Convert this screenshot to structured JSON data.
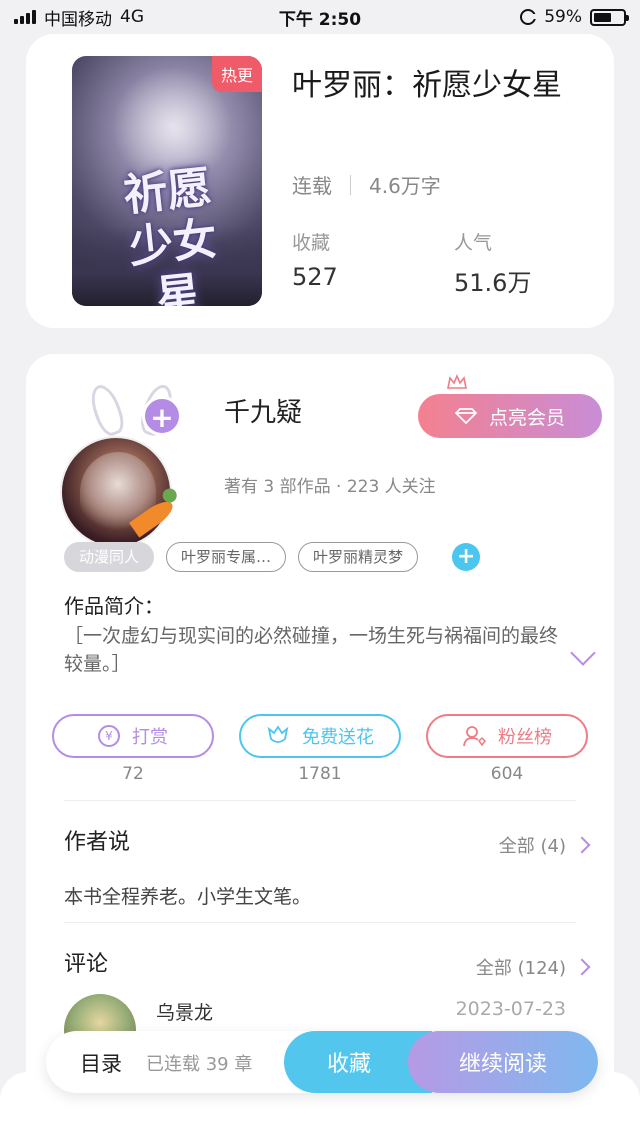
{
  "status_bar": {
    "carrier": "中国移动",
    "network": "4G",
    "time": "下午 2:50",
    "battery": "59%",
    "battery_level": 0.59
  },
  "book": {
    "title": "叶罗丽：祈愿少女星",
    "cover_title": "祈愿少女星",
    "cover_tag": "热更",
    "status": "连载",
    "word_count": "4.6万字",
    "stats": [
      {
        "label": "收藏",
        "value": "527"
      },
      {
        "label": "人气",
        "value": "51.6万"
      }
    ]
  },
  "author": {
    "name": "千九疑",
    "summary": "著有 3 部作品 · 223 人关注",
    "follow_symbol": "+",
    "vip_button": "点亮会员"
  },
  "tags": {
    "items": [
      "动漫同人",
      "叶罗丽专属…",
      "叶罗丽精灵梦"
    ],
    "add_symbol": "+"
  },
  "intro": {
    "label": "作品简介：",
    "text": "［一次虚幻与现实间的必然碰撞，一场生死与祸福间的最终较量。］"
  },
  "actions": [
    {
      "label": "打赏",
      "count": "72",
      "icon": "yen-icon",
      "color": "#b48ce6"
    },
    {
      "label": "免费送花",
      "count": "1781",
      "icon": "flower-icon",
      "color": "#4cc6ee"
    },
    {
      "label": "粉丝榜",
      "count": "604",
      "icon": "fan-icon",
      "color": "#ef7b85"
    }
  ],
  "author_say": {
    "title": "作者说",
    "more": "全部 (4)",
    "content": "本书全程养老。小学生文笔。"
  },
  "comments": {
    "title": "评论",
    "more": "全部 (124)",
    "first": {
      "user": "乌景龙",
      "date": "2023-07-23"
    }
  },
  "bottom_bar": {
    "toc": "目录",
    "status": "已连载 39 章",
    "favorite": "收藏",
    "continue": "继续阅读"
  }
}
